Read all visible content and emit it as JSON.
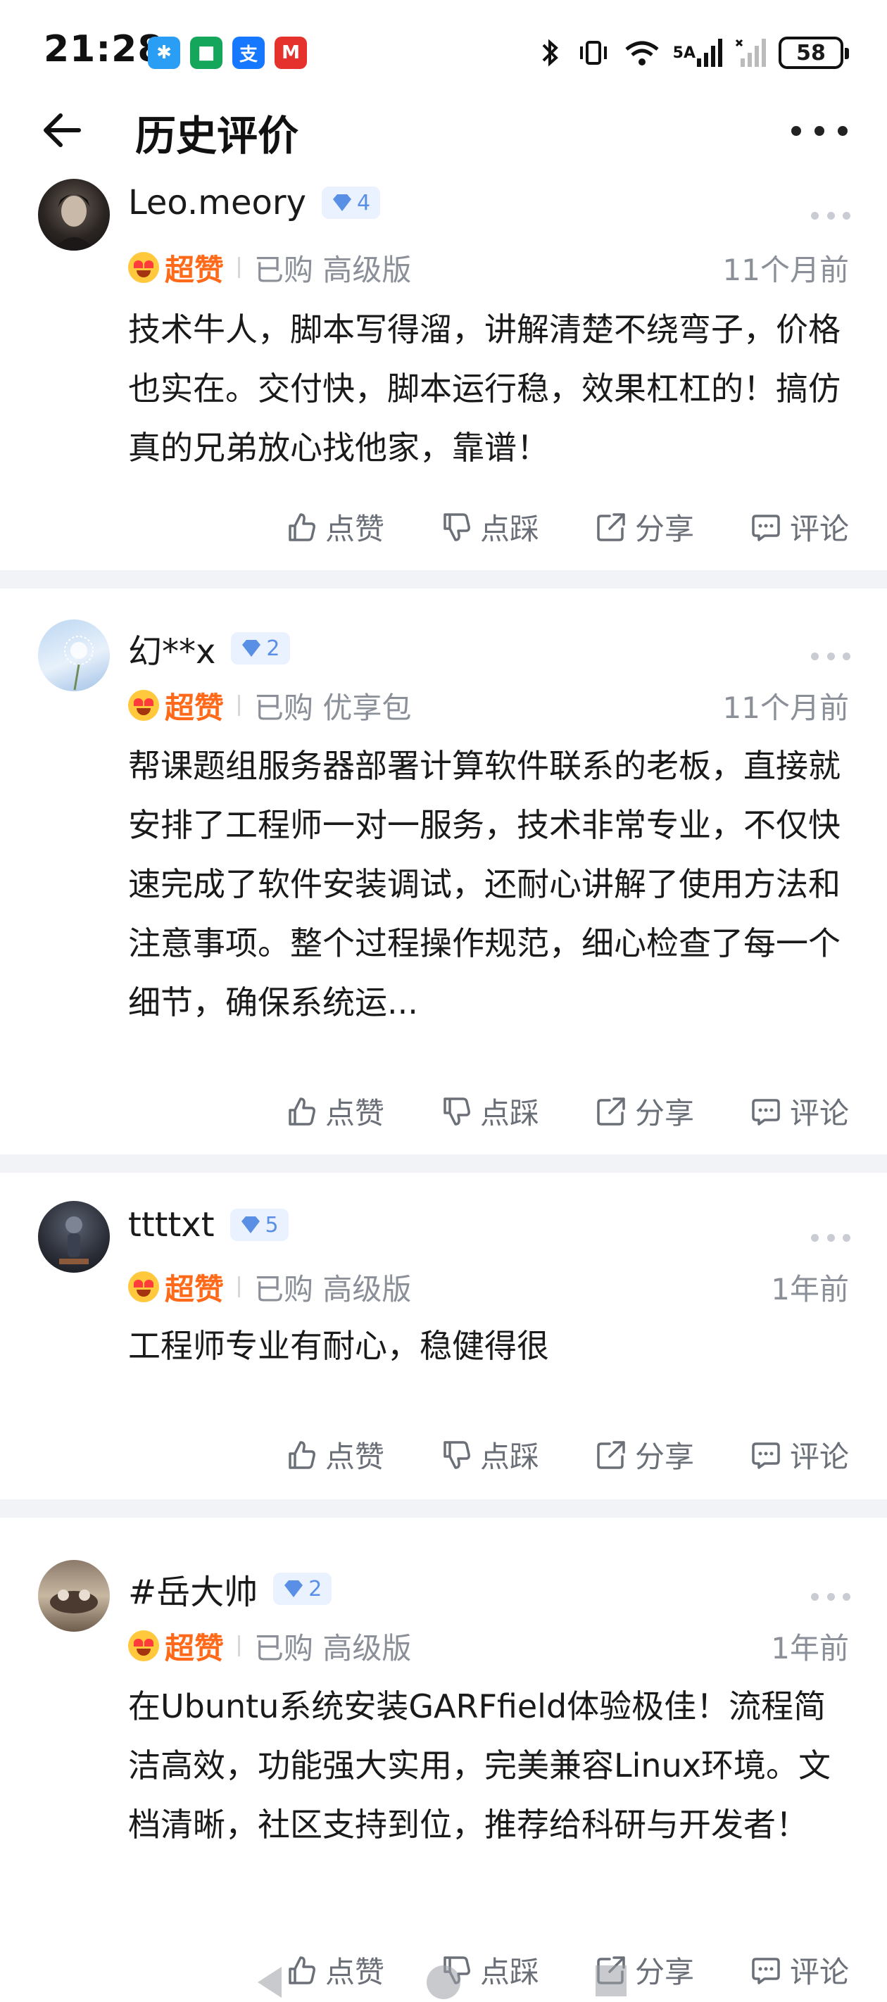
{
  "status_bar": {
    "time": "21:28",
    "notif_icons": [
      {
        "name": "app-icon-blue",
        "color": "#2a9df4",
        "glyph": "✱"
      },
      {
        "name": "app-icon-green",
        "color": "#14a65a",
        "glyph": "■"
      },
      {
        "name": "alipay-icon",
        "color": "#1677ff",
        "glyph": "支"
      },
      {
        "name": "app-icon-red",
        "color": "#e5322d",
        "glyph": "M"
      }
    ],
    "network": "5A",
    "battery": "58"
  },
  "header": {
    "title": "历史评价"
  },
  "actions_labels": {
    "like": "点赞",
    "dislike": "点踩",
    "share": "分享",
    "comment": "评论"
  },
  "reviews": [
    {
      "username": "Leo.meory",
      "level": "4",
      "rating": "超赞",
      "purchase": "已购 高级版",
      "time": "11个月前",
      "text": "技术牛人，脚本写得溜，讲解清楚不绕弯子，价格也实在。交付快，脚本运行稳，效果杠杠的！搞仿真的兄弟放心找他家，靠谱！"
    },
    {
      "username": "幻**x",
      "level": "2",
      "rating": "超赞",
      "purchase": "已购 优享包",
      "time": "11个月前",
      "text": "帮课题组服务器部署计算软件联系的老板，直接就安排了工程师一对一服务，技术非常专业，不仅快速完成了软件安装调试，还耐心讲解了使用方法和注意事项。整个过程操作规范，细心检查了每一个细节，确保系统运..."
    },
    {
      "username": "ttttxt",
      "level": "5",
      "rating": "超赞",
      "purchase": "已购 高级版",
      "time": "1年前",
      "text": "工程师专业有耐心，稳健得很"
    },
    {
      "username": "#岳大帅",
      "level": "2",
      "rating": "超赞",
      "purchase": "已购 高级版",
      "time": "1年前",
      "text": "在Ubuntu系统安装GARFfield体验极佳！流程简洁高效，功能强大实用，完美兼容Linux环境。文档清晰，社区支持到位，推荐给科研与开发者！"
    }
  ],
  "colors": {
    "rating_orange": "#ff6a1a",
    "muted_gray": "#8a8f98",
    "level_blue": "#5a8fe6",
    "divider_bg": "#f1f3f6"
  }
}
